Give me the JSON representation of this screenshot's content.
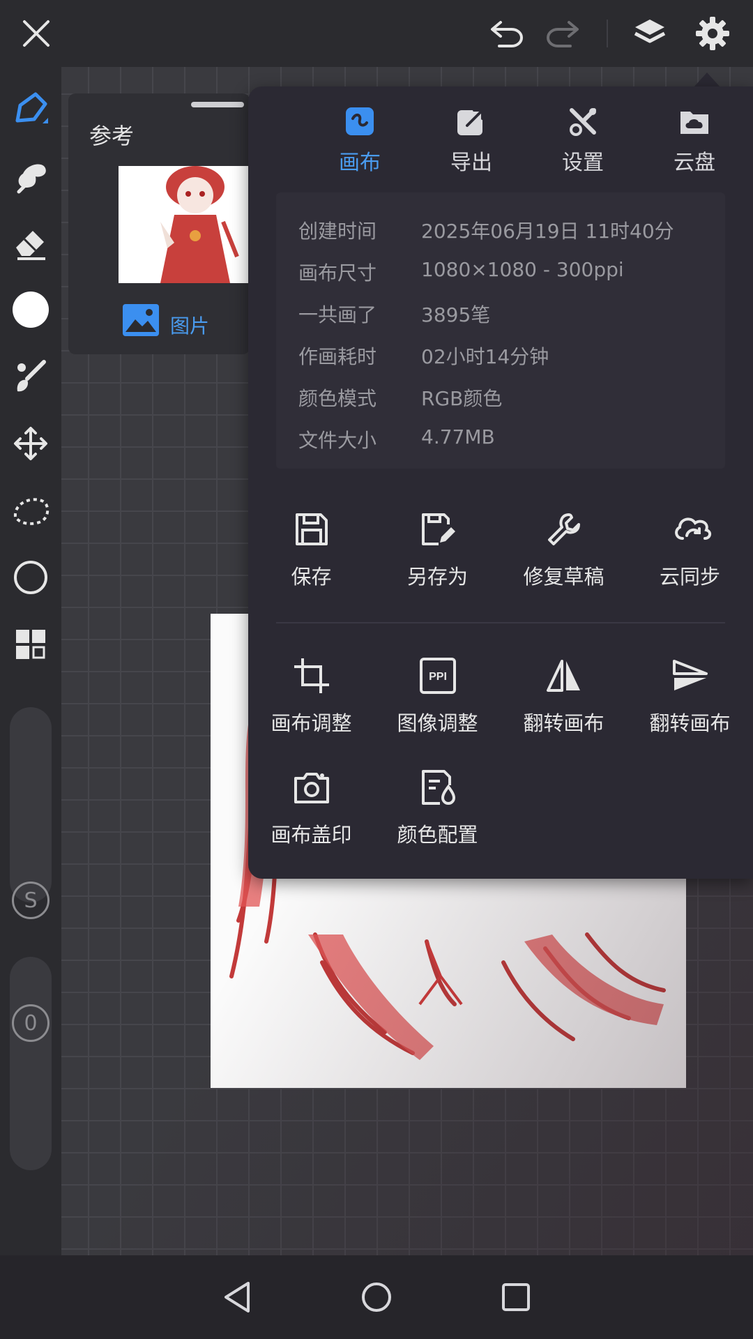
{
  "toolbar_top": {
    "close_icon": "close-icon",
    "undo_icon": "undo-icon",
    "redo_icon": "redo-icon",
    "layers_icon": "layers-icon",
    "settings_icon": "gear-icon"
  },
  "left_tools": [
    "pen-tool-icon",
    "smudge-tool-icon",
    "eraser-tool-icon",
    "color-swatch",
    "brush-settings-icon",
    "move-tool-icon",
    "lasso-selection-icon",
    "shape-tool-icon",
    "grid-panel-icon"
  ],
  "sliders": {
    "size_badge": "S",
    "opacity_badge": "0"
  },
  "reference_panel": {
    "title": "参考",
    "image_button_label": "图片"
  },
  "tabs": [
    {
      "label": "画布",
      "active": true
    },
    {
      "label": "导出",
      "active": false
    },
    {
      "label": "设置",
      "active": false
    },
    {
      "label": "云盘",
      "active": false
    }
  ],
  "canvas_info": [
    {
      "key": "创建时间",
      "value": "2025年06月19日 11时40分"
    },
    {
      "key": "画布尺寸",
      "value": "1080×1080 - 300ppi"
    },
    {
      "key": "一共画了",
      "value": "3895笔"
    },
    {
      "key": "作画耗时",
      "value": "02小时14分钟"
    },
    {
      "key": "颜色模式",
      "value": "RGB颜色"
    },
    {
      "key": "文件大小",
      "value": "4.77MB"
    }
  ],
  "file_actions": [
    {
      "label": "保存",
      "icon": "save-icon"
    },
    {
      "label": "另存为",
      "icon": "save-as-icon"
    },
    {
      "label": "修复草稿",
      "icon": "wrench-icon"
    },
    {
      "label": "云同步",
      "icon": "cloud-sync-icon"
    }
  ],
  "canvas_actions": [
    {
      "label": "画布调整",
      "icon": "crop-icon"
    },
    {
      "label": "图像调整",
      "icon": "ppi-icon"
    },
    {
      "label": "翻转画布",
      "icon": "flip-horizontal-icon"
    },
    {
      "label": "翻转画布",
      "icon": "flip-vertical-icon"
    },
    {
      "label": "画布盖印",
      "icon": "camera-icon"
    },
    {
      "label": "颜色配置",
      "icon": "color-profile-icon"
    }
  ],
  "nav": [
    "back-icon",
    "home-icon",
    "recents-icon"
  ],
  "colors": {
    "accent": "#4a9cf0",
    "panel": "#2b2933",
    "toolbar": "#2b2b2f"
  }
}
